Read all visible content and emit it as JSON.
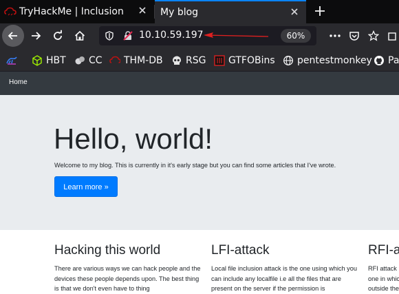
{
  "browser": {
    "tabs": [
      {
        "title": "TryHackMe | Inclusion",
        "active": false
      },
      {
        "title": "My blog",
        "active": true
      }
    ],
    "url": "10.10.59.197",
    "zoom": "60%",
    "bookmarks": [
      {
        "label": "",
        "icon": "kali-dragon-icon"
      },
      {
        "label": "HBT",
        "icon": "cube-icon"
      },
      {
        "label": "CC",
        "icon": "cc-icon"
      },
      {
        "label": "THM-DB",
        "icon": "thm-icon"
      },
      {
        "label": "RSG",
        "icon": "skull-icon"
      },
      {
        "label": "GTFOBins",
        "icon": "gtfobins-icon"
      },
      {
        "label": "pentestmonkey",
        "icon": "globe-icon"
      },
      {
        "label": "Pa",
        "icon": "github-icon"
      }
    ],
    "colors": {
      "accent": "#0a84ff",
      "annotation_arrow": "#e02020"
    }
  },
  "page": {
    "nav": {
      "home": "Home"
    },
    "jumbotron": {
      "title": "Hello, world!",
      "lead": "Welcome to my blog. This is currently in it's early stage but you can find some articles that I've wrote.",
      "button": "Learn more »"
    },
    "columns": [
      {
        "heading": "Hacking this world",
        "text": "There are various ways we can hack people and the devices these people depends upon. The best thing is that we don't even have to thing"
      },
      {
        "heading": "LFI-attack",
        "text": "Local file inclusion attack is the one using which you can include any localfile i.e all the files that are present on the server if the permission is"
      },
      {
        "heading": "RFI-a",
        "lines": [
          "RFI attack",
          "one in whic",
          "outside the"
        ]
      }
    ],
    "colors": {
      "primary": "#007bff",
      "navbar": "#343a40",
      "jumbotron": "#e9ecef"
    }
  }
}
